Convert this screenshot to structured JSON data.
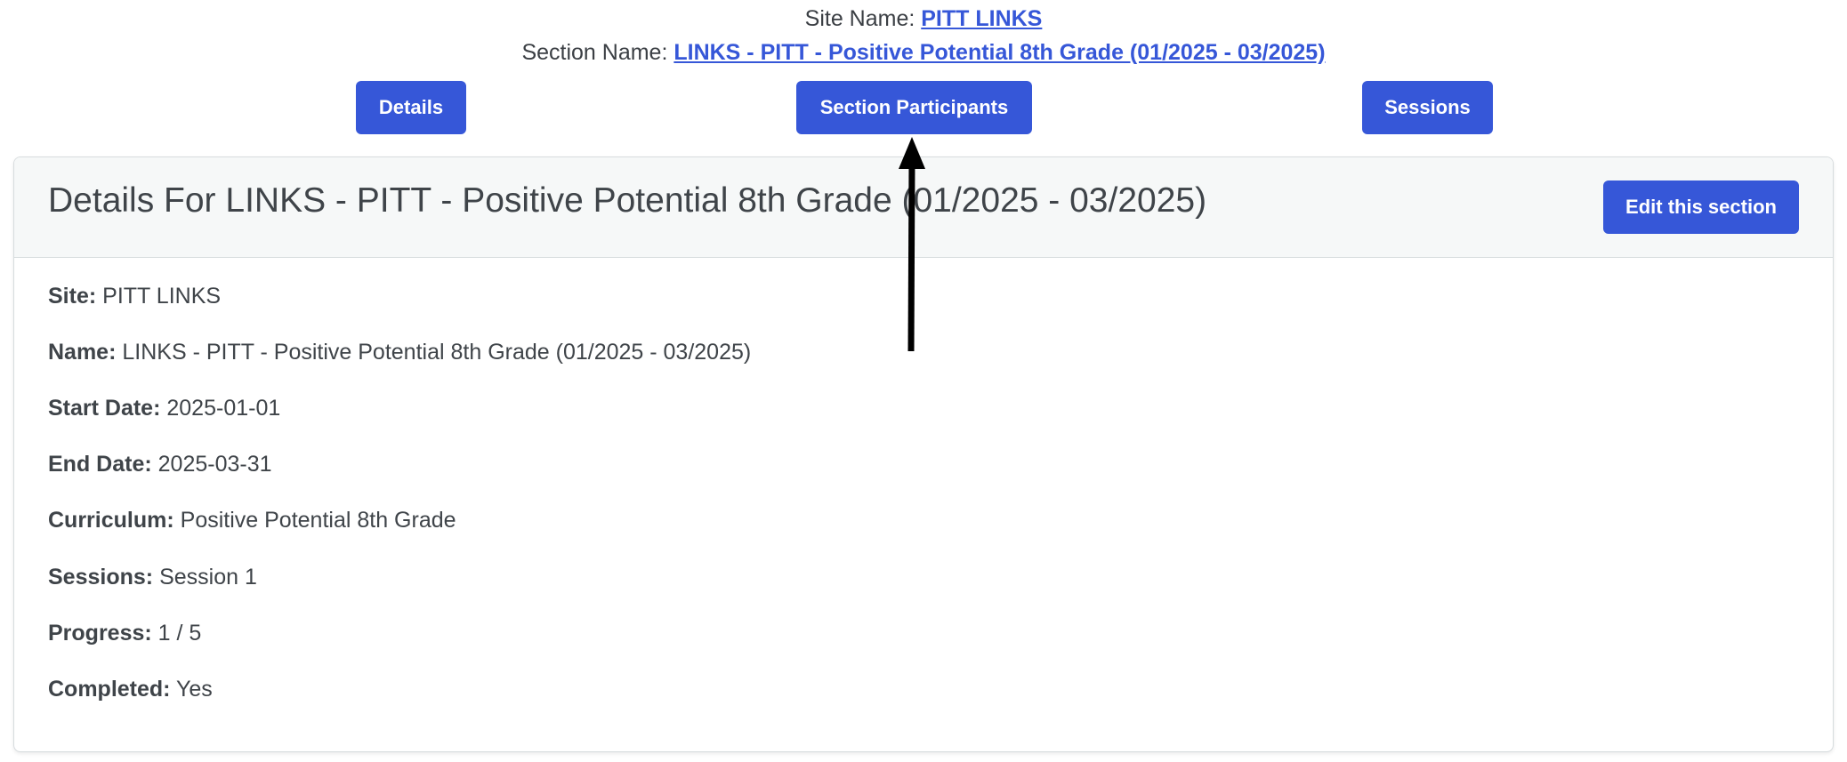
{
  "header": {
    "site_prefix": "Site Name: ",
    "site_link": "PITT LINKS",
    "section_prefix": "Section Name: ",
    "section_link": "LINKS - PITT - Positive Potential 8th Grade (01/2025 - 03/2025)"
  },
  "nav": {
    "details": "Details",
    "participants": "Section Participants",
    "sessions": "Sessions"
  },
  "card": {
    "title": "Details For LINKS - PITT - Positive Potential 8th Grade (01/2025 - 03/2025)",
    "edit_label": "Edit this section"
  },
  "fields": {
    "site": {
      "label": "Site:",
      "value": "PITT LINKS"
    },
    "name": {
      "label": "Name:",
      "value": "LINKS - PITT - Positive Potential 8th Grade (01/2025 - 03/2025)"
    },
    "start_date": {
      "label": "Start Date:",
      "value": "2025-01-01"
    },
    "end_date": {
      "label": "End Date:",
      "value": "2025-03-31"
    },
    "curriculum": {
      "label": "Curriculum:",
      "value": "Positive Potential 8th Grade"
    },
    "sessions": {
      "label": "Sessions:",
      "value": "Session 1"
    },
    "progress": {
      "label": "Progress:",
      "value": "1 / 5"
    },
    "completed": {
      "label": "Completed:",
      "value": "Yes"
    }
  },
  "colors": {
    "accent": "#3657d8",
    "header_bg": "#f6f8f8",
    "text": "#3f4449"
  },
  "annotation": {
    "icon": "arrow-up-icon"
  }
}
